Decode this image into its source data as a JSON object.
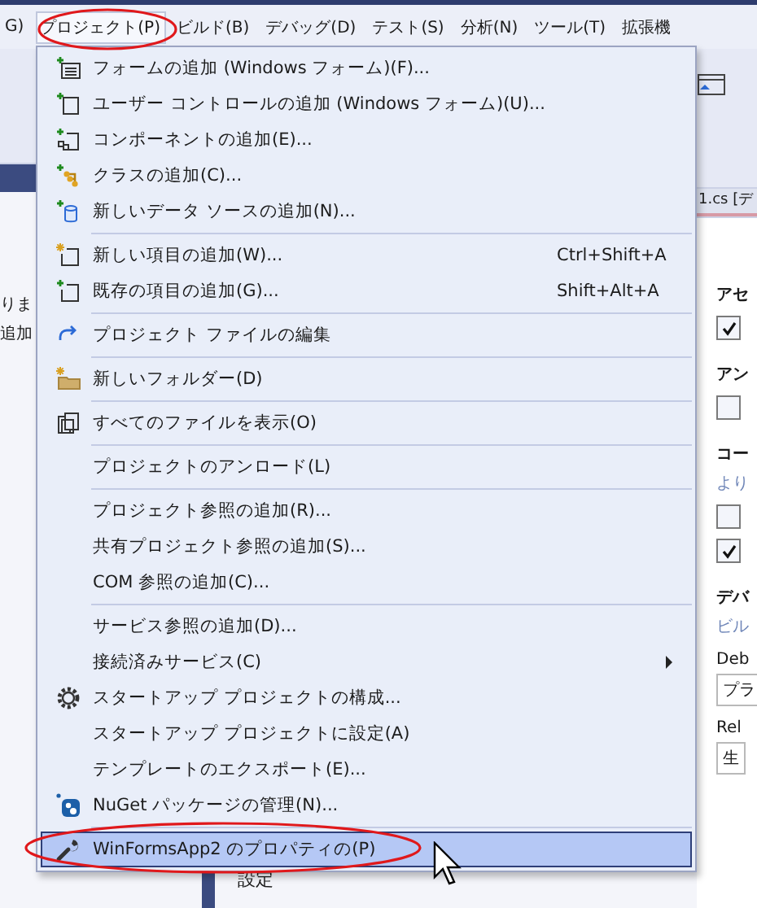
{
  "menubar": [
    {
      "label": "G)",
      "selected": false
    },
    {
      "label": "プロジェクト(P)",
      "selected": true
    },
    {
      "label": "ビルド(B)",
      "selected": false
    },
    {
      "label": "デバッグ(D)",
      "selected": false
    },
    {
      "label": "テスト(S)",
      "selected": false
    },
    {
      "label": "分析(N)",
      "selected": false
    },
    {
      "label": "ツール(T)",
      "selected": false
    },
    {
      "label": "拡張機",
      "selected": false
    }
  ],
  "menu": {
    "groups": [
      [
        {
          "kind": "form-add",
          "label": "フォームの追加 (Windows フォーム)(F)...",
          "selected": false
        },
        {
          "kind": "control-add",
          "label": "ユーザー コントロールの追加 (Windows フォーム)(U)...",
          "selected": false
        },
        {
          "kind": "component-add",
          "label": "コンポーネントの追加(E)...",
          "selected": false
        },
        {
          "kind": "class-add",
          "label": "クラスの追加(C)...",
          "selected": false
        },
        {
          "kind": "datasource-add",
          "label": "新しいデータ ソースの追加(N)...",
          "selected": false
        }
      ],
      [
        {
          "kind": "new-item",
          "label": "新しい項目の追加(W)...",
          "shortcut": "Ctrl+Shift+A",
          "selected": false
        },
        {
          "kind": "existing-item",
          "label": "既存の項目の追加(G)...",
          "shortcut": "Shift+Alt+A",
          "selected": false
        }
      ],
      [
        {
          "kind": "edit",
          "label": "プロジェクト ファイルの編集",
          "selected": false
        }
      ],
      [
        {
          "kind": "folder",
          "label": "新しいフォルダー(D)",
          "selected": false
        }
      ],
      [
        {
          "kind": "files",
          "label": "すべてのファイルを表示(O)",
          "selected": false
        }
      ],
      [
        {
          "label": "プロジェクトのアンロード(L)",
          "selected": false
        }
      ],
      [
        {
          "label": "プロジェクト参照の追加(R)...",
          "selected": false
        },
        {
          "label": "共有プロジェクト参照の追加(S)...",
          "selected": false
        },
        {
          "label": "COM 参照の追加(C)...",
          "selected": false
        }
      ],
      [
        {
          "label": "サービス参照の追加(D)...",
          "selected": false
        },
        {
          "label": "接続済みサービス(C)",
          "submenu": true,
          "selected": false
        },
        {
          "kind": "gear",
          "label": "スタートアップ プロジェクトの構成...",
          "selected": false
        },
        {
          "label": "スタートアップ プロジェクトに設定(A)",
          "selected": false
        },
        {
          "label": "テンプレートのエクスポート(E)...",
          "selected": false
        },
        {
          "kind": "nuget",
          "label": "NuGet パッケージの管理(N)...",
          "selected": false
        }
      ],
      [
        {
          "kind": "wrench",
          "label": "WinFormsApp2 のプロパティの(P)",
          "selected": true
        }
      ]
    ]
  },
  "background": {
    "tab_title": "1.cs [デ",
    "left_texts": [
      "りま",
      "追加"
    ],
    "panel": [
      {
        "kind": "heading",
        "text": "アセ"
      },
      {
        "kind": "checkbox",
        "checked": true
      },
      {
        "kind": "heading",
        "text": "アン"
      },
      {
        "kind": "checkbox",
        "checked": false
      },
      {
        "kind": "heading",
        "text": "コー"
      },
      {
        "kind": "hint",
        "text": "より"
      },
      {
        "kind": "checkbox",
        "checked": false
      },
      {
        "kind": "checkbox",
        "checked": true
      },
      {
        "kind": "heading",
        "text": "デバ"
      },
      {
        "kind": "hint",
        "text": "ビル"
      },
      {
        "kind": "label",
        "text": "Deb"
      },
      {
        "kind": "select",
        "text": "プラ"
      },
      {
        "kind": "label",
        "text": "Rel"
      },
      {
        "kind": "select",
        "text": "生"
      }
    ],
    "footer_text": "設定"
  }
}
